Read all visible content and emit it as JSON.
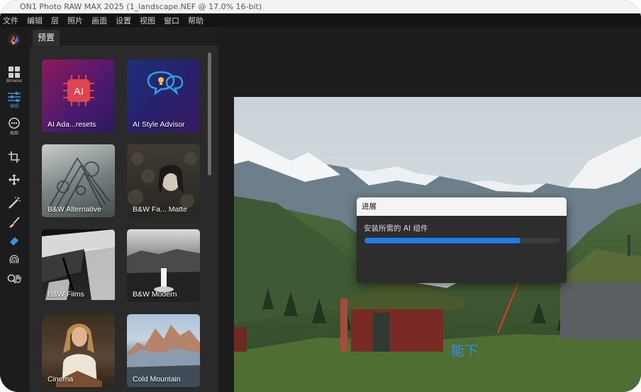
{
  "window": {
    "title": "ON1 Photo RAW MAX 2025 (1_landscape.NEF @ 17.0% 16-bit)"
  },
  "menubar": {
    "items": [
      "文件",
      "编辑",
      "层",
      "照片",
      "画面",
      "设置",
      "视图",
      "窗口",
      "帮助"
    ]
  },
  "toolbar": {
    "browse_label": "Browse",
    "edit_label": "编辑",
    "local_label": "局部"
  },
  "presets_panel": {
    "tab_label": "预置",
    "tiles": [
      {
        "label": "AI Ada...resets"
      },
      {
        "label": "AI Style Advisor"
      },
      {
        "label": "B&W Alternative"
      },
      {
        "label": "B&W Fa... Matte"
      },
      {
        "label": "B&W Films"
      },
      {
        "label": "B&W Modern"
      },
      {
        "label": "Cinema"
      },
      {
        "label": "Cold Mountain"
      }
    ]
  },
  "progress_dialog": {
    "title": "进展",
    "message": "安装所需的 AI 组件",
    "progress": 0.8
  },
  "annotation": {
    "text": "能下",
    "color": "#2f8fe8"
  },
  "colors": {
    "accent": "#1f7be6",
    "annotation_arrow": "#e03a2f"
  }
}
